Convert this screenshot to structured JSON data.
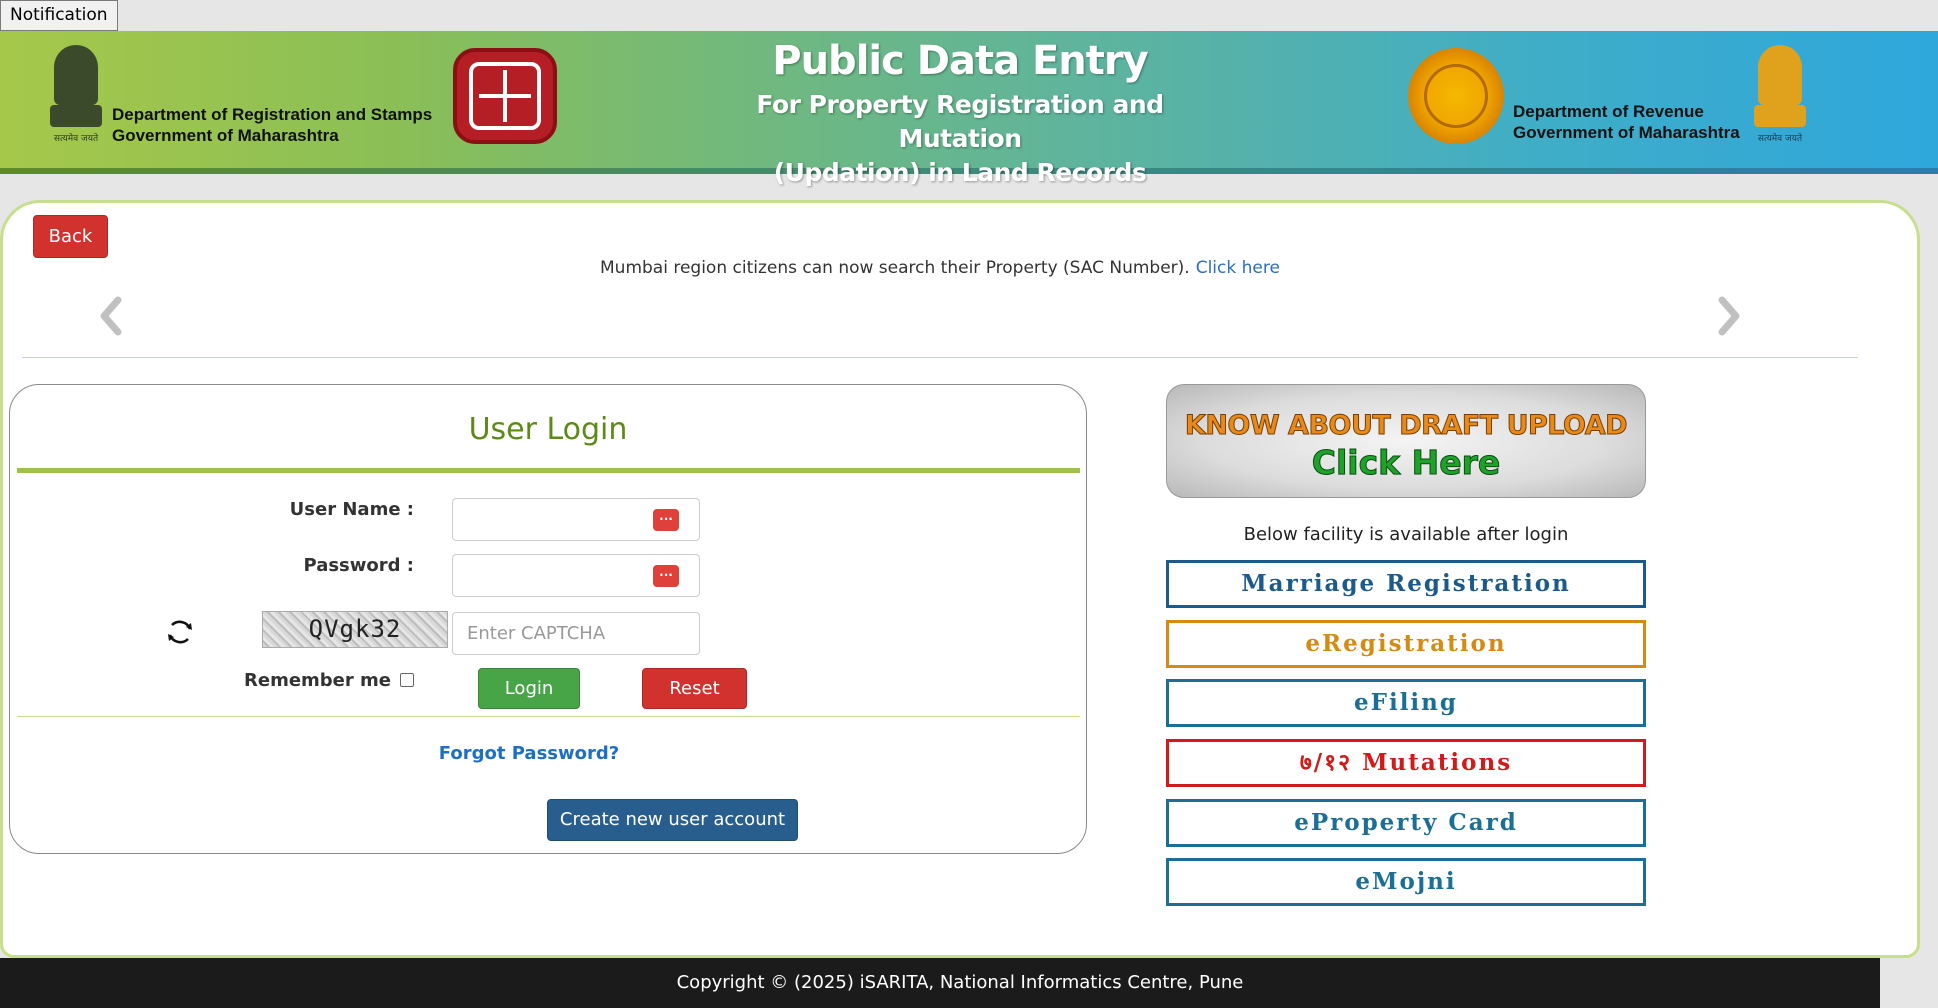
{
  "notification": {
    "label": "Notification"
  },
  "header": {
    "left_dept_line1": "Department of Registration and Stamps",
    "left_dept_line2": "Government of Maharashtra",
    "title_line1": "Public Data Entry",
    "title_line2": "For Property Registration and Mutation",
    "title_line3": "(Updation) in Land Records",
    "right_dept_line1": "Department of Revenue",
    "right_dept_line2": "Government of Maharashtra",
    "emblem_motto": "सत्यमेव जयते"
  },
  "nav": {
    "back_label": "Back"
  },
  "marquee": {
    "text": "Mumbai region citizens can now search their Property (SAC Number).",
    "link_text": "Click here"
  },
  "login": {
    "title": "User Login",
    "username_label": "User Name :",
    "password_label": "Password :",
    "captcha_code": "QVgk32",
    "captcha_placeholder": "Enter CAPTCHA",
    "remember_label": "Remember me",
    "login_label": "Login",
    "reset_label": "Reset",
    "forgot_label": "Forgot Password?",
    "create_label": "Create new user account",
    "pw_icon": "···"
  },
  "draft": {
    "line1": "KNOW ABOUT DRAFT UPLOAD",
    "line2": "Click Here"
  },
  "facilities": {
    "intro": "Below facility is available after login",
    "items": [
      {
        "label": "Marriage Registration",
        "color": "#1c5a8c"
      },
      {
        "label": "eRegistration",
        "color": "#d68a12"
      },
      {
        "label": "eFiling",
        "color": "#1c6f94"
      },
      {
        "label": "७/१२ Mutations",
        "color": "#d11b1b"
      },
      {
        "label": "eProperty Card",
        "color": "#1c6f94"
      },
      {
        "label": "eMojni",
        "color": "#1c6f94"
      }
    ]
  },
  "footer": {
    "text": "Copyright © (2025) iSARITA, National Informatics Centre, Pune"
  }
}
